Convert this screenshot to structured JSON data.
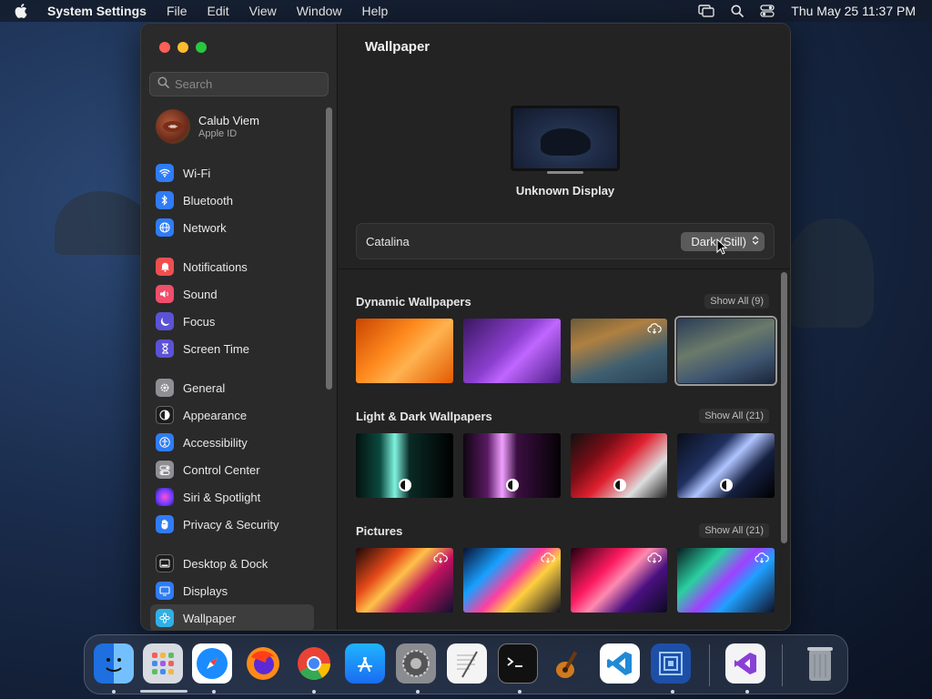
{
  "menubar": {
    "app": "System Settings",
    "items": [
      "File",
      "Edit",
      "View",
      "Window",
      "Help"
    ],
    "clock": "Thu May 25  11:37 PM"
  },
  "sidebar": {
    "search_placeholder": "Search",
    "profile": {
      "name": "Calub Viem",
      "sub": "Apple ID"
    },
    "items": [
      {
        "label": "Wi-Fi",
        "icon": "wifi-icon",
        "color": "#2f7cf6"
      },
      {
        "label": "Bluetooth",
        "icon": "bluetooth-icon",
        "color": "#2f7cf6"
      },
      {
        "label": "Network",
        "icon": "globe-icon",
        "color": "#2f7cf6"
      },
      {
        "label": "Notifications",
        "icon": "bell-icon",
        "color": "#f04e4e"
      },
      {
        "label": "Sound",
        "icon": "speaker-icon",
        "color": "#f04e6a"
      },
      {
        "label": "Focus",
        "icon": "moon-icon",
        "color": "#5b52d6"
      },
      {
        "label": "Screen Time",
        "icon": "hourglass-icon",
        "color": "#5b52d6"
      },
      {
        "label": "General",
        "icon": "gear-icon",
        "color": "#8e8e93"
      },
      {
        "label": "Appearance",
        "icon": "appearance-icon",
        "color": "#1c1c1e"
      },
      {
        "label": "Accessibility",
        "icon": "accessibility-icon",
        "color": "#2f7cf6"
      },
      {
        "label": "Control Center",
        "icon": "toggles-icon",
        "color": "#8e8e93"
      },
      {
        "label": "Siri & Spotlight",
        "icon": "siri-icon",
        "color": "#a24bd6"
      },
      {
        "label": "Privacy & Security",
        "icon": "hand-icon",
        "color": "#2f7cf6"
      },
      {
        "label": "Desktop & Dock",
        "icon": "dock-icon",
        "color": "#1c1c1e"
      },
      {
        "label": "Displays",
        "icon": "display-icon",
        "color": "#2f7cf6"
      },
      {
        "label": "Wallpaper",
        "icon": "flower-icon",
        "color": "#2fb0e6"
      }
    ]
  },
  "content": {
    "title": "Wallpaper",
    "display_label": "Unknown Display",
    "current_wallpaper": "Catalina",
    "mode_selected": "Dark (Still)",
    "sections": [
      {
        "title": "Dynamic Wallpapers",
        "show_all": "Show All (9)"
      },
      {
        "title": "Light & Dark Wallpapers",
        "show_all": "Show All (21)"
      },
      {
        "title": "Pictures",
        "show_all": "Show All (21)"
      }
    ]
  },
  "dock": {
    "apps": [
      "Finder",
      "Launchpad",
      "Safari",
      "Firefox",
      "Chrome",
      "App Store",
      "System Settings",
      "TextEdit",
      "Terminal",
      "GarageBand",
      "Visual Studio Code",
      "Xcode Instruments",
      "Visual Studio",
      "Trash"
    ]
  }
}
